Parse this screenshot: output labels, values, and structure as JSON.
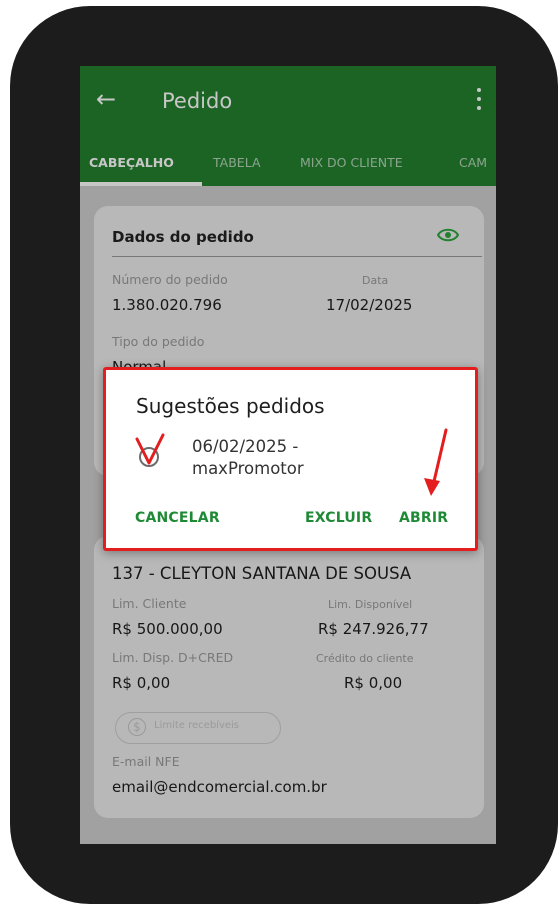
{
  "header": {
    "title": "Pedido",
    "back_icon": "arrow-left-icon",
    "menu_icon": "more-vert-icon"
  },
  "tabs": [
    {
      "label": "CABEÇALHO",
      "active": true
    },
    {
      "label": "TABELA"
    },
    {
      "label": "MIX DO CLIENTE"
    },
    {
      "label": "CAM"
    }
  ],
  "order": {
    "section_title": "Dados do pedido",
    "numero_label": "Número do pedido",
    "numero_value": "1.380.020.796",
    "data_label": "Data",
    "data_value": "17/02/2025",
    "tipo_label": "Tipo do pedido",
    "tipo_value": "Normal"
  },
  "client": {
    "name": "137 - CLEYTON SANTANA DE SOUSA",
    "lim_cliente_label": "Lim. Cliente",
    "lim_cliente_value": "R$ 500.000,00",
    "lim_disp_label": "Lim. Disponível",
    "lim_disp_value": "R$ 247.926,77",
    "lim_dcred_label": "Lim. Disp. D+CRED",
    "lim_dcred_value": "R$ 0,00",
    "credito_label": "Crédito do cliente",
    "credito_value": "R$ 0,00",
    "chip_label": "Limite recebíveis",
    "chip_icon": "dollar-icon",
    "email_label": "E-mail NFE",
    "email_value": "email@endcomercial.com.br"
  },
  "dialog": {
    "title": "Sugestões pedidos",
    "option_line1": "06/02/2025 -",
    "option_line2": "maxPromotor",
    "cancel_label": "CANCELAR",
    "delete_label": "EXCLUIR",
    "open_label": "ABRIR"
  },
  "colors": {
    "primary": "#23802f",
    "accent": "#1f8a36",
    "annotation": "#e41e1e"
  }
}
